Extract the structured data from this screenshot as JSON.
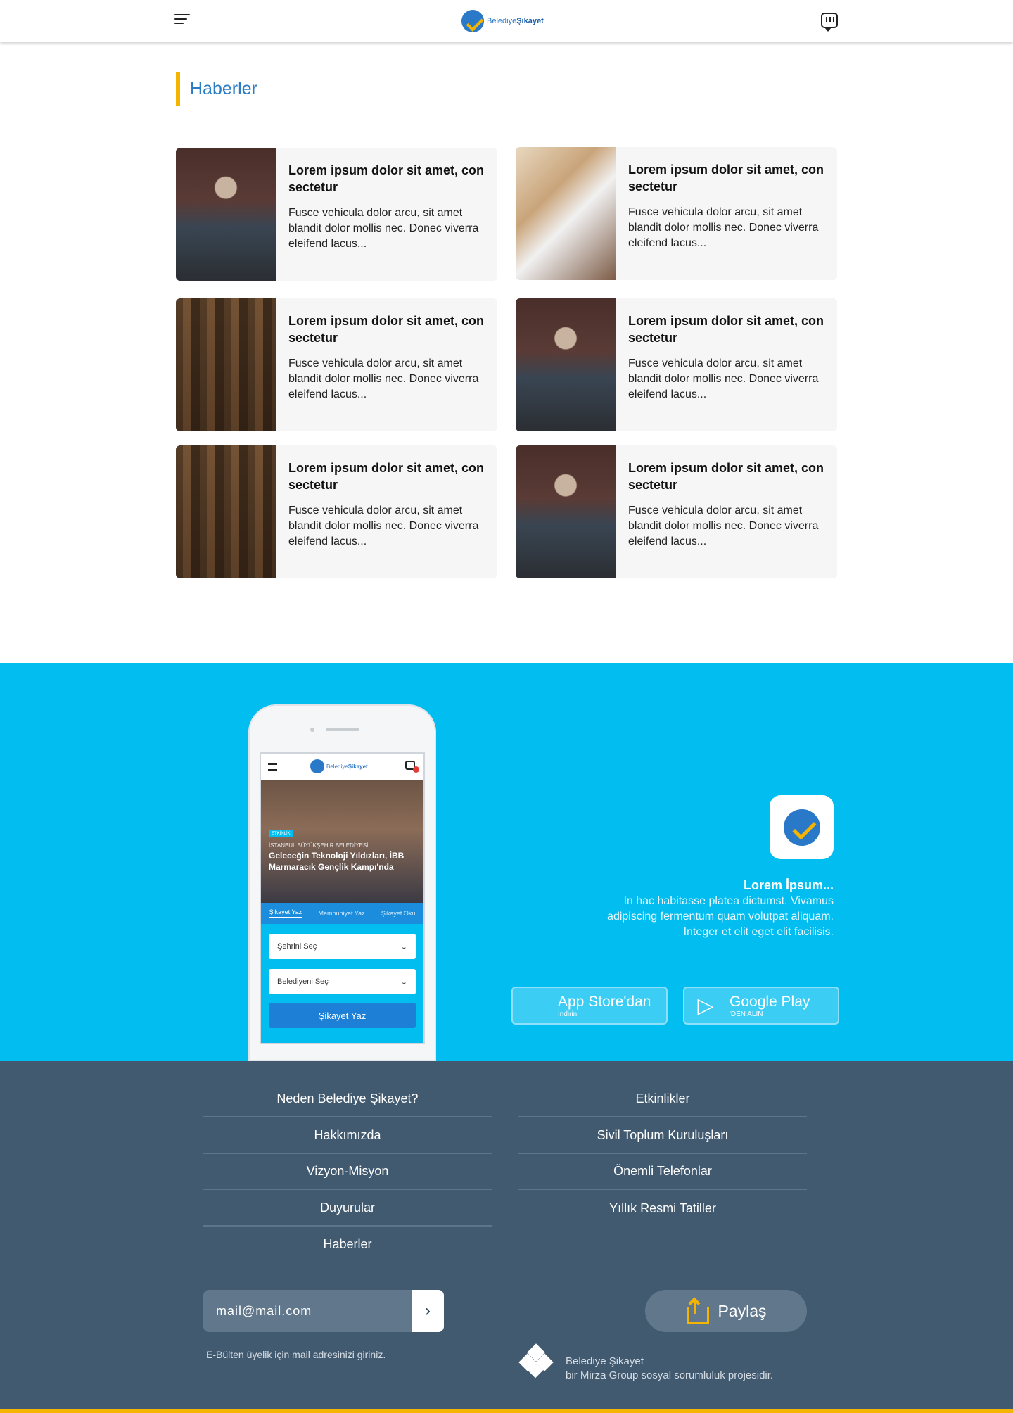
{
  "header": {
    "logo_text_a": "Belediye",
    "logo_text_b": "Şikayet"
  },
  "news": {
    "title": "Haberler",
    "items": [
      {
        "image": "man-reading",
        "title": "Lorem ipsum dolor sit amet, con sectetur",
        "text": "Fusce vehicula dolor arcu, sit amet blandit dolor mollis nec. Donec viverra eleifend lacus..."
      },
      {
        "image": "kids-drawing",
        "title": "Lorem ipsum dolor sit amet, con sectetur",
        "text": "Fusce vehicula dolor arcu, sit amet blandit dolor mollis nec. Donec viverra eleifend lacus..."
      },
      {
        "image": "cistern",
        "title": "Lorem ipsum dolor sit amet, con sectetur",
        "text": "Fusce vehicula dolor arcu, sit amet blandit dolor mollis nec. Donec viverra eleifend lacus..."
      },
      {
        "image": "man-reading",
        "title": "Lorem ipsum dolor sit amet, con sectetur",
        "text": "Fusce vehicula dolor arcu, sit amet blandit dolor mollis nec. Donec viverra eleifend lacus..."
      },
      {
        "image": "cistern",
        "title": "Lorem ipsum dolor sit amet, con sectetur",
        "text": "Fusce vehicula dolor arcu, sit amet blandit dolor mollis nec. Donec viverra eleifend lacus..."
      },
      {
        "image": "man-reading",
        "title": "Lorem ipsum dolor sit amet, con sectetur",
        "text": "Fusce vehicula dolor arcu, sit amet blandit dolor mollis nec. Donec viverra eleifend lacus..."
      }
    ]
  },
  "phone_screen": {
    "logo_text_a": "Belediye",
    "logo_text_b": "Şikayet",
    "tag": "ETKİNLİK",
    "subtitle": "İSTANBUL BÜYÜKŞEHİR BELEDİYESİ",
    "headline": "Geleceğin Teknoloji Yıldızları, İBB Marmaracık Gençlik Kampı'nda",
    "tabs": [
      "Şikayet Yaz",
      "Memnuniyet Yaz",
      "Şikayet Oku"
    ],
    "select_city": "Şehrini Seç",
    "select_municipality": "Belediyeni Seç",
    "submit": "Şikayet Yaz"
  },
  "promo": {
    "title": "Lorem İpsum...",
    "text": "In hac habitasse platea dictumst. Vivamus adipiscing fermentum quam volutpat aliquam. Integer et elit eget elit facilisis.",
    "appstore_big": "App Store'dan",
    "appstore_small": "İndirin",
    "play_big": "Google Play",
    "play_small": "'DEN ALIN"
  },
  "footer": {
    "left_links": [
      "Neden Belediye Şikayet?",
      "Hakkımızda",
      "Vizyon-Misyon",
      "Duyurular",
      "Haberler"
    ],
    "right_links": [
      "Etkinlikler",
      "Sivil Toplum Kuruluşları",
      "Önemli Telefonlar",
      "Yıllık Resmi Tatiller"
    ],
    "mail_value": "mail@mail.com",
    "mail_hint": "E-Bülten üyelik için mail adresinizi  giriniz.",
    "share_label": "Paylaş",
    "brand_line1": "Belediye Şikayet",
    "brand_line2": "bir Mirza Group sosyal sorumluluk projesidir."
  },
  "colors": {
    "accent": "#f5b400",
    "promo_bg": "#02bdf0",
    "footer_bg": "#425a70",
    "title_blue": "#2a7cc4"
  }
}
